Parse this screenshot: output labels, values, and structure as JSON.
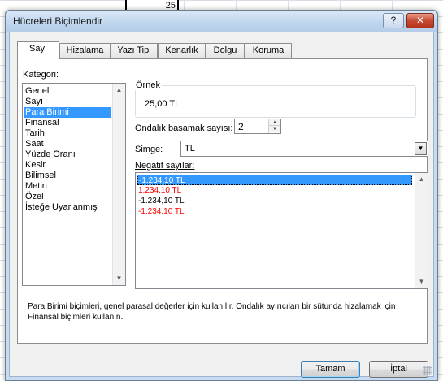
{
  "sheet": {
    "cell_value": "25"
  },
  "dialog": {
    "title": "Hücreleri Biçimlendir",
    "help_label": "?",
    "close_label": "✕"
  },
  "tabs": [
    {
      "label": "Sayı",
      "active": true
    },
    {
      "label": "Hizalama"
    },
    {
      "label": "Yazı Tipi"
    },
    {
      "label": "Kenarlık"
    },
    {
      "label": "Dolgu"
    },
    {
      "label": "Koruma"
    }
  ],
  "category": {
    "label": "Kategori:",
    "items": [
      "Genel",
      "Sayı",
      "Para Birimi",
      "Finansal",
      "Tarih",
      "Saat",
      "Yüzde Oranı",
      "Kesir",
      "Bilimsel",
      "Metin",
      "Özel",
      "İsteğe Uyarlanmış"
    ],
    "selected": "Para Birimi"
  },
  "sample": {
    "label": "Örnek",
    "value": "25,00 TL"
  },
  "decimal": {
    "label": "Ondalık basamak sayısı:",
    "value": "2"
  },
  "symbol": {
    "label": "Simge:",
    "value": "TL"
  },
  "negative": {
    "label": "Negatif sayılar:",
    "items": [
      {
        "text": "-1.234,10 TL",
        "color": "#000000",
        "selected": true
      },
      {
        "text": "1.234,10 TL",
        "color": "#ff0000"
      },
      {
        "text": "-1.234,10 TL",
        "color": "#000000"
      },
      {
        "text": "-1.234,10 TL",
        "color": "#ff0000"
      }
    ]
  },
  "description": "Para Birimi biçimleri, genel parasal değerler için kullanılır. Ondalık ayırıcıları bir sütunda hizalamak için Finansal biçimleri kullanın.",
  "buttons": {
    "ok": "Tamam",
    "cancel": "İptal"
  },
  "colors": {
    "selection": "#3399ff",
    "negative_red": "#ff0000",
    "title_bar": "#c6dbf1"
  }
}
